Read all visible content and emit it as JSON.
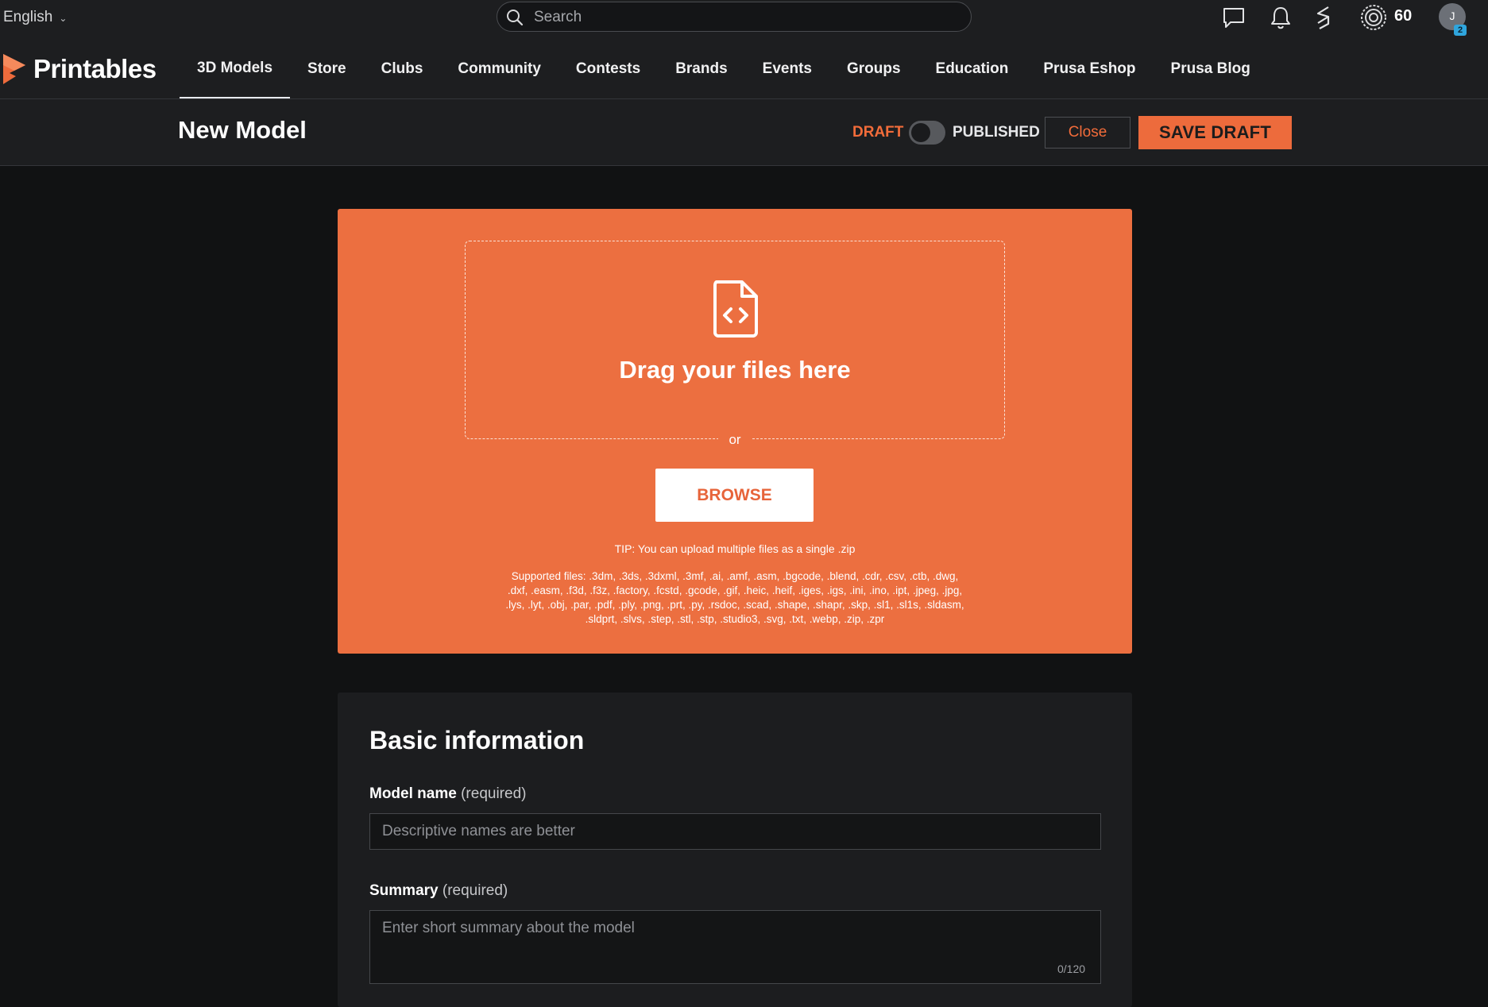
{
  "topbar": {
    "language": "English",
    "search_placeholder": "Search",
    "points": "60",
    "avatar_initial": "J",
    "avatar_badge": "2"
  },
  "brand": {
    "name": "Printables",
    "accent": "#ed6b3c"
  },
  "nav": {
    "items": [
      {
        "label": "3D Models",
        "active": true
      },
      {
        "label": "Store"
      },
      {
        "label": "Clubs"
      },
      {
        "label": "Community"
      },
      {
        "label": "Contests"
      },
      {
        "label": "Brands"
      },
      {
        "label": "Events"
      },
      {
        "label": "Groups"
      },
      {
        "label": "Education"
      },
      {
        "label": "Prusa Eshop"
      },
      {
        "label": "Prusa Blog"
      }
    ]
  },
  "header": {
    "title": "New Model",
    "draft_label": "DRAFT",
    "published_label": "PUBLISHED",
    "close_label": "Close",
    "save_label": "SAVE DRAFT"
  },
  "upload": {
    "drag_text": "Drag your files here",
    "or_text": "or",
    "browse_label": "BROWSE",
    "tip": "TIP: You can upload multiple files as a single .zip",
    "supported": "Supported files: .3dm, .3ds, .3dxml, .3mf, .ai, .amf, .asm, .bgcode, .blend, .cdr, .csv, .ctb, .dwg, .dxf, .easm, .f3d, .f3z, .factory, .fcstd, .gcode, .gif, .heic, .heif, .iges, .igs, .ini, .ino, .ipt, .jpeg, .jpg, .lys, .lyt, .obj, .par, .pdf, .ply, .png, .prt, .py, .rsdoc, .scad, .shape, .shapr, .skp, .sl1, .sl1s, .sldasm, .sldprt, .slvs, .step, .stl, .stp, .studio3, .svg, .txt, .webp, .zip, .zpr"
  },
  "basic_info": {
    "title": "Basic information",
    "model_name": {
      "label": "Model name",
      "required": "(required)",
      "placeholder": "Descriptive names are better"
    },
    "summary": {
      "label": "Summary",
      "required": "(required)",
      "placeholder": "Enter short summary about the model",
      "counter": "0/120"
    }
  }
}
